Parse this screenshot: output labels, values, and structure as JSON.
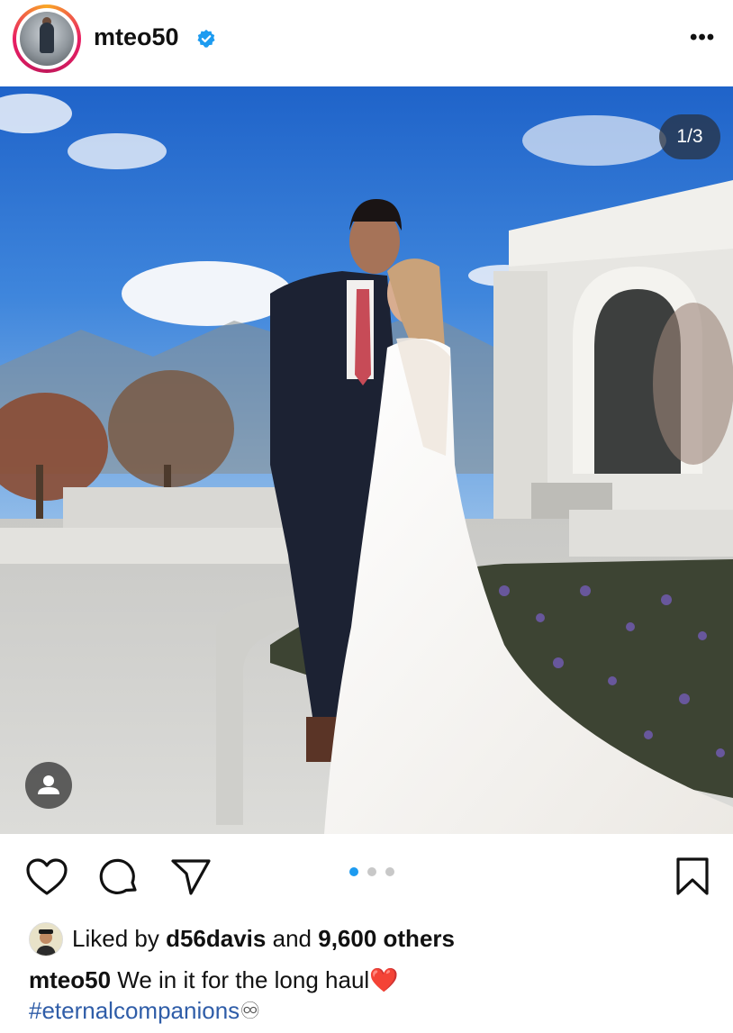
{
  "header": {
    "username": "mteo50",
    "verified": true,
    "more_label": "•••",
    "avatar_icon": "profile-avatar"
  },
  "post": {
    "counter": "1/3",
    "current_slide": 1,
    "total_slides": 3,
    "tag_icon": "person-icon"
  },
  "actions": {
    "like_icon": "heart-icon",
    "comment_icon": "comment-bubble-icon",
    "share_icon": "paper-plane-icon",
    "save_icon": "bookmark-icon"
  },
  "likes": {
    "prefix": "Liked by",
    "user": "d56davis",
    "conjunction": "and",
    "count": "9,600 others"
  },
  "caption": {
    "username": "mteo50",
    "text": "We in it for the long haul",
    "emoji": "❤️",
    "hashtag": "#eternalcompanions",
    "hashtag_emoji": "♾"
  },
  "colors": {
    "verified": "#1d9bf0",
    "active_dot": "#1d9bf0",
    "inactive_dot": "#c8c8c8",
    "hashtag": "#2f5da8",
    "heart": "#e0202c"
  }
}
